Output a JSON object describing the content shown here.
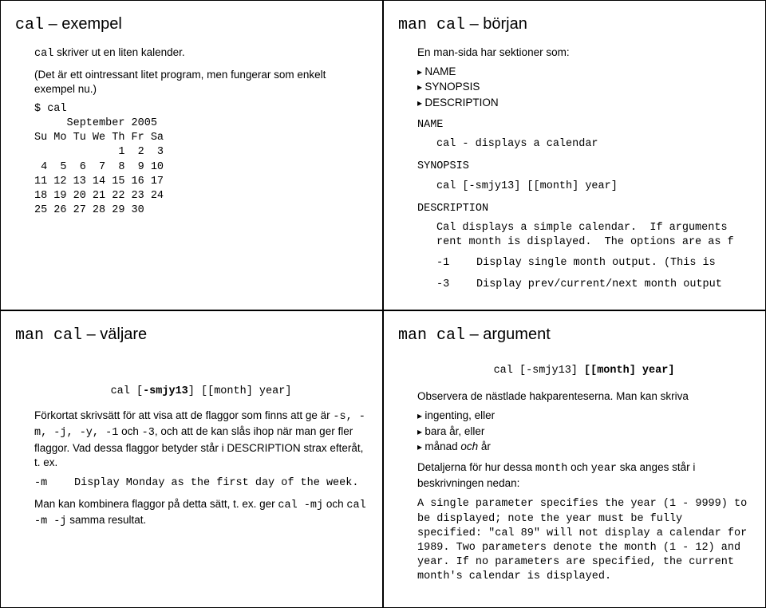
{
  "tl": {
    "title_cmd": "cal",
    "title_sep": " – ",
    "title_rest": "exempel",
    "line1a": "cal",
    "line1b": " skriver ut en liten kalender.",
    "line2": "(Det är ett ointressant litet program, men fungerar som enkelt exempel nu.)",
    "cal_out": "$ cal\n     September 2005\nSu Mo Tu We Th Fr Sa\n             1  2  3\n 4  5  6  7  8  9 10\n11 12 13 14 15 16 17\n18 19 20 21 22 23 24\n25 26 27 28 29 30"
  },
  "tr": {
    "title_cmd": "man cal",
    "title_sep": " – ",
    "title_rest": "början",
    "intro": "En man-sida har sektioner som:",
    "b1": "NAME",
    "b2": "SYNOPSIS",
    "b3": "DESCRIPTION",
    "name_label": "NAME",
    "name_line": "cal - displays a calendar",
    "syn_label": "SYNOPSIS",
    "syn_line": "cal [-smjy13] [[month] year]",
    "desc_label": "DESCRIPTION",
    "desc_line": "Cal displays a simple calendar.  If arguments rent month is displayed.  The options are as f",
    "opt1_flag": "-1",
    "opt1_text": "Display single month output.  (This is",
    "opt2_flag": "-3",
    "opt2_text": "Display prev/current/next month output"
  },
  "bl": {
    "title_cmd": "man cal",
    "title_sep": " – ",
    "title_rest": "väljare",
    "syn_pre": "cal [",
    "syn_bold": "-smjy13",
    "syn_post": "] [[month] year]",
    "p1a": "Förkortat skrivsätt för att visa att de flaggor som finns att ge är ",
    "p1flags": "-s, -m, -j, -y, -1",
    "p1b": " och ",
    "p1flag3": "-3",
    "p1c": ", och att de kan slås ihop när man ger fler flaggor. Vad dessa flaggor betyder står i DESCRIPTION strax efteråt, t. ex.",
    "mflag": "-m",
    "mtext": "Display Monday as the first day of the week.",
    "p2a": "Man kan kombinera flaggor på detta sätt, t. ex. ger ",
    "p2code1": "cal -mj",
    "p2b": " och ",
    "p2code2": "cal -m -j",
    "p2c": " samma resultat."
  },
  "br": {
    "title_cmd": "man cal",
    "title_sep": " – ",
    "title_rest": "argument",
    "syn_pre": "cal [-smjy13] ",
    "syn_bold": "[[month] year]",
    "p1": "Observera de nästlade hakparenteserna. Man kan skriva",
    "b1": "ingenting, eller",
    "b2": "bara år, eller",
    "b3_a": "månad ",
    "b3_i": "och",
    "b3_b": " år",
    "p2a": "Detaljerna för hur dessa ",
    "p2m1": "month",
    "p2b": " och ",
    "p2m2": "year",
    "p2c": " ska anges står i beskrivningen nedan:",
    "desc": "A single parameter specifies the year (1 - 9999) to be displayed; note the year must be fully specified: \"cal 89\" will not display a calendar for 1989. Two parameters denote the month (1 - 12) and year. If no parameters are specified, the current month's calendar is displayed."
  }
}
